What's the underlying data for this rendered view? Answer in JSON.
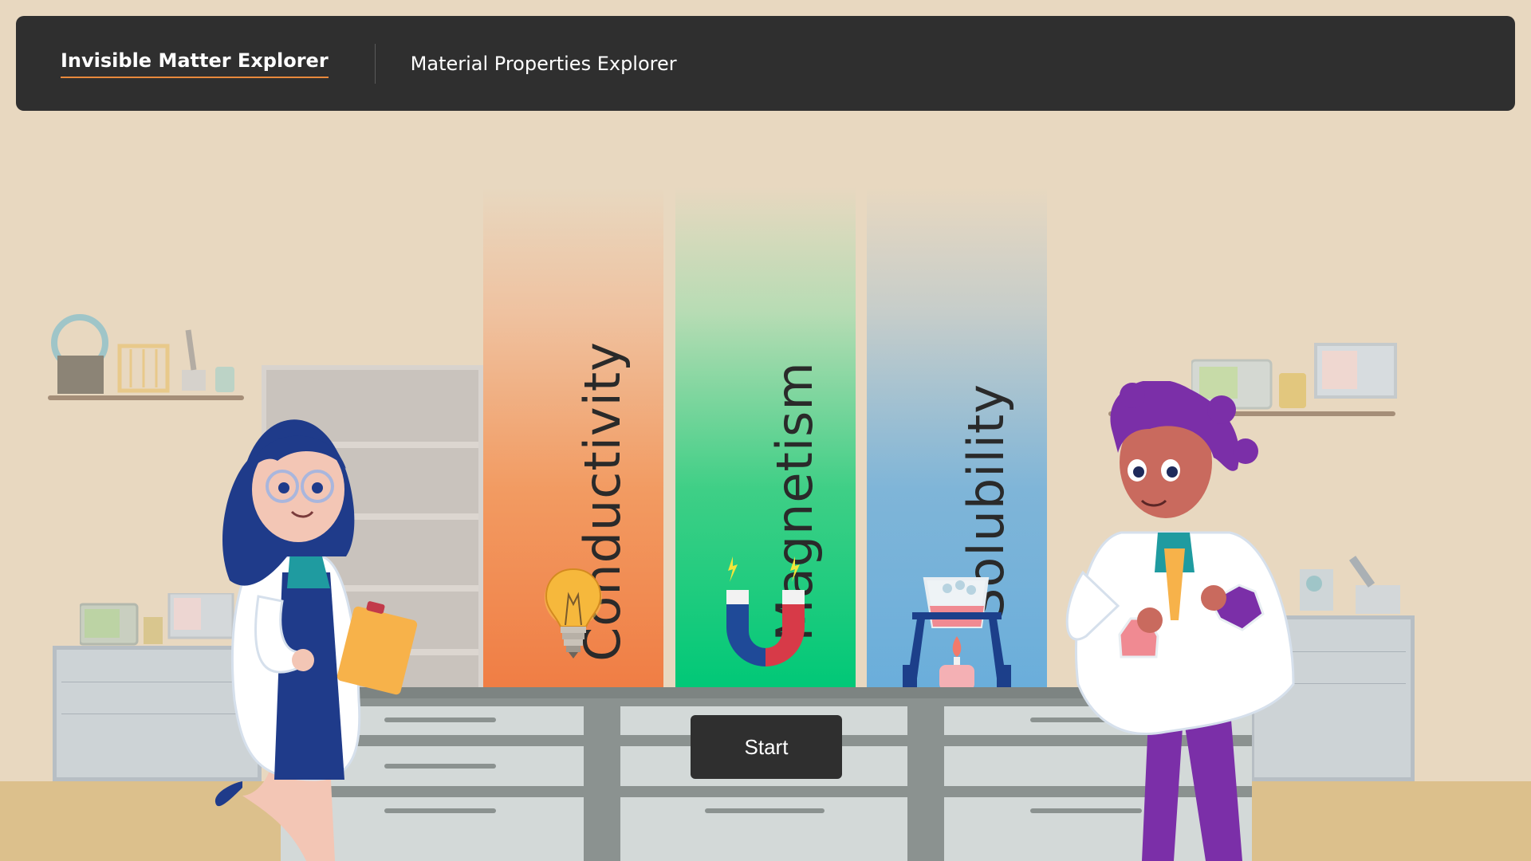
{
  "nav": {
    "active_tab": "Invisible Matter Explorer",
    "second_tab": "Material Properties Explorer"
  },
  "panels": [
    {
      "label": "Conductivity",
      "icon": "lightbulb-icon"
    },
    {
      "label": "Magnetism",
      "icon": "horseshoe-magnet-icon"
    },
    {
      "label": "Solubility",
      "icon": "beaker-burner-icon"
    }
  ],
  "start_button": {
    "label": "Start"
  },
  "colors": {
    "topbar": "#2f2f2f",
    "accent_underline": "#e8893c",
    "conductivity": "#f07d44",
    "magnetism": "#00c877",
    "solubility": "#6aaedb",
    "background": "#e8d8c0"
  }
}
